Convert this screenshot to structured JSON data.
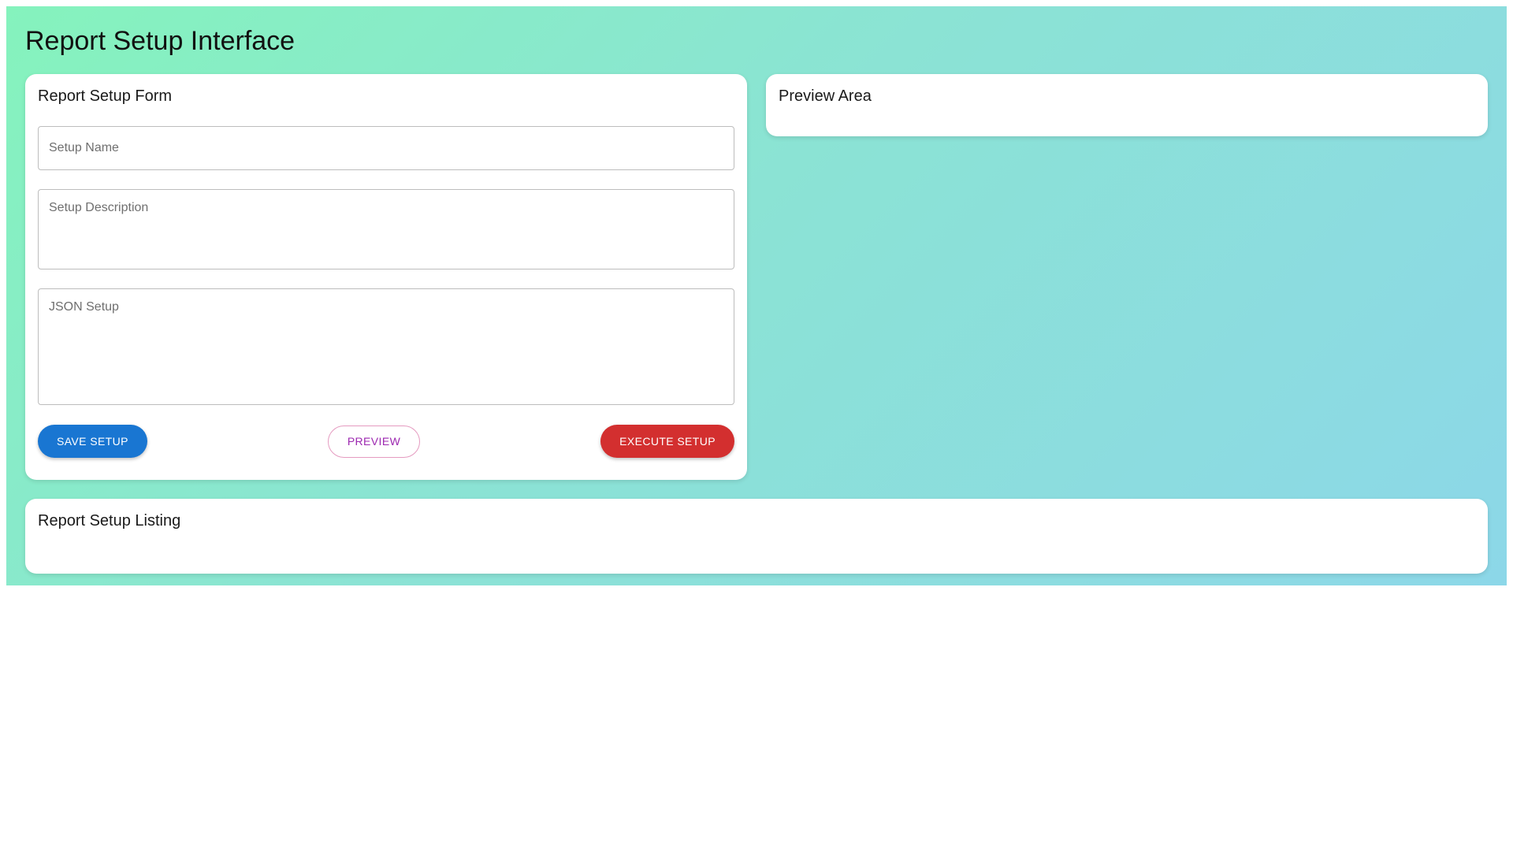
{
  "page": {
    "title": "Report Setup Interface"
  },
  "form": {
    "title": "Report Setup Form",
    "setup_name_placeholder": "Setup Name",
    "setup_description_placeholder": "Setup Description",
    "json_setup_placeholder": "JSON Setup",
    "save_label": "SAVE SETUP",
    "preview_label": "PREVIEW",
    "execute_label": "EXECUTE SETUP"
  },
  "preview": {
    "title": "Preview Area"
  },
  "listing": {
    "title": "Report Setup Listing"
  },
  "colors": {
    "background_gradient_start": "#85f3bd",
    "background_gradient_end": "#8cd7e8",
    "save_button": "#1976d2",
    "preview_button_text": "#9c27b0",
    "execute_button": "#d32f2f"
  }
}
